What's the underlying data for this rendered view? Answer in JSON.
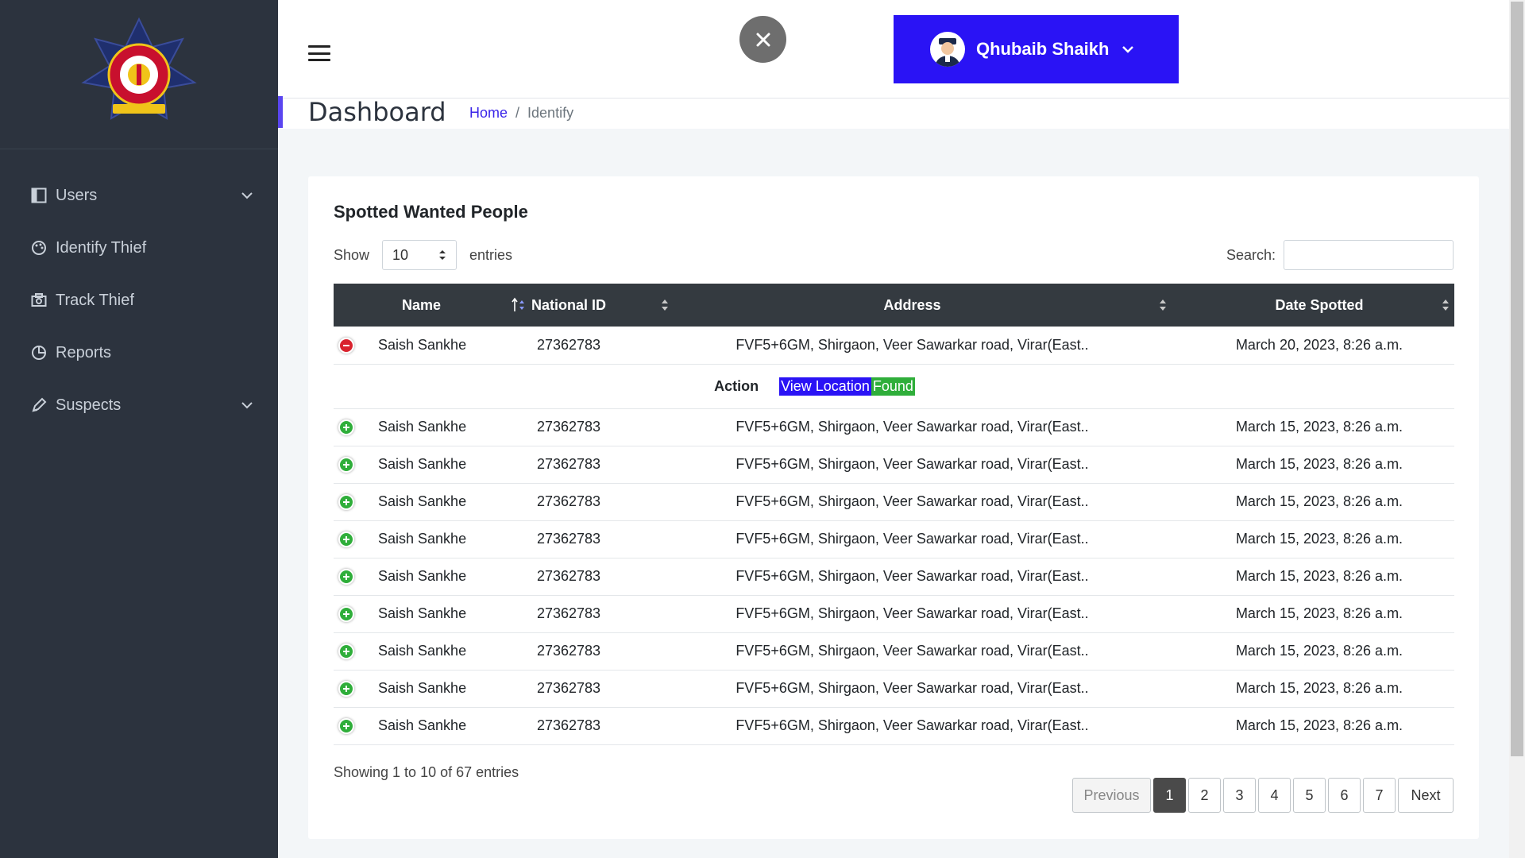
{
  "sidebar": {
    "logo_alt": "Greater Mumbai Police",
    "items": [
      {
        "label": "Users",
        "icon": "columns-icon",
        "has_dropdown": true
      },
      {
        "label": "Identify Thief",
        "icon": "palette-icon",
        "has_dropdown": false
      },
      {
        "label": "Track Thief",
        "icon": "camera-icon",
        "has_dropdown": false
      },
      {
        "label": "Reports",
        "icon": "pie-chart-icon",
        "has_dropdown": false
      },
      {
        "label": "Suspects",
        "icon": "pen-icon",
        "has_dropdown": true
      }
    ]
  },
  "header": {
    "user_name": "Qhubaib Shaikh",
    "user_button_color": "#2a13f5"
  },
  "page": {
    "title": "Dashboard",
    "breadcrumb_home": "Home",
    "breadcrumb_sep": "/",
    "breadcrumb_current": "Identify"
  },
  "card": {
    "title": "Spotted Wanted People",
    "show_label": "Show",
    "entries_value": "10",
    "entries_label": "entries",
    "search_label": "Search:",
    "search_value": ""
  },
  "table": {
    "headers": [
      "Name",
      "National ID",
      "Address",
      "Date Spotted"
    ],
    "expanded_row": {
      "name": "Saish Sankhe",
      "national_id": "27362783",
      "address": "FVF5+6GM, Shirgaon, Veer Sawarkar road, Virar(East..",
      "date": "March 20, 2023, 8:26 a.m.",
      "action_label": "Action",
      "view_location_label": "View Location",
      "found_label": "Found"
    },
    "rows": [
      {
        "name": "Saish Sankhe",
        "national_id": "27362783",
        "address": "FVF5+6GM, Shirgaon, Veer Sawarkar road, Virar(East..",
        "date": "March 15, 2023, 8:26 a.m."
      },
      {
        "name": "Saish Sankhe",
        "national_id": "27362783",
        "address": "FVF5+6GM, Shirgaon, Veer Sawarkar road, Virar(East..",
        "date": "March 15, 2023, 8:26 a.m."
      },
      {
        "name": "Saish Sankhe",
        "national_id": "27362783",
        "address": "FVF5+6GM, Shirgaon, Veer Sawarkar road, Virar(East..",
        "date": "March 15, 2023, 8:26 a.m."
      },
      {
        "name": "Saish Sankhe",
        "national_id": "27362783",
        "address": "FVF5+6GM, Shirgaon, Veer Sawarkar road, Virar(East..",
        "date": "March 15, 2023, 8:26 a.m."
      },
      {
        "name": "Saish Sankhe",
        "national_id": "27362783",
        "address": "FVF5+6GM, Shirgaon, Veer Sawarkar road, Virar(East..",
        "date": "March 15, 2023, 8:26 a.m."
      },
      {
        "name": "Saish Sankhe",
        "national_id": "27362783",
        "address": "FVF5+6GM, Shirgaon, Veer Sawarkar road, Virar(East..",
        "date": "March 15, 2023, 8:26 a.m."
      },
      {
        "name": "Saish Sankhe",
        "national_id": "27362783",
        "address": "FVF5+6GM, Shirgaon, Veer Sawarkar road, Virar(East..",
        "date": "March 15, 2023, 8:26 a.m."
      },
      {
        "name": "Saish Sankhe",
        "national_id": "27362783",
        "address": "FVF5+6GM, Shirgaon, Veer Sawarkar road, Virar(East..",
        "date": "March 15, 2023, 8:26 a.m."
      },
      {
        "name": "Saish Sankhe",
        "national_id": "27362783",
        "address": "FVF5+6GM, Shirgaon, Veer Sawarkar road, Virar(East..",
        "date": "March 15, 2023, 8:26 a.m."
      }
    ]
  },
  "footer": {
    "info": "Showing 1 to 10 of 67 entries",
    "previous_label": "Previous",
    "pages": [
      "1",
      "2",
      "3",
      "4",
      "5",
      "6",
      "7"
    ],
    "active_page": "1",
    "next_label": "Next"
  },
  "colors": {
    "sidebar_bg": "#2c333e",
    "accent_blue": "#2a13f5",
    "success_green": "#2fae3a",
    "danger_red": "#d9232e",
    "table_header_bg": "#343a40"
  }
}
